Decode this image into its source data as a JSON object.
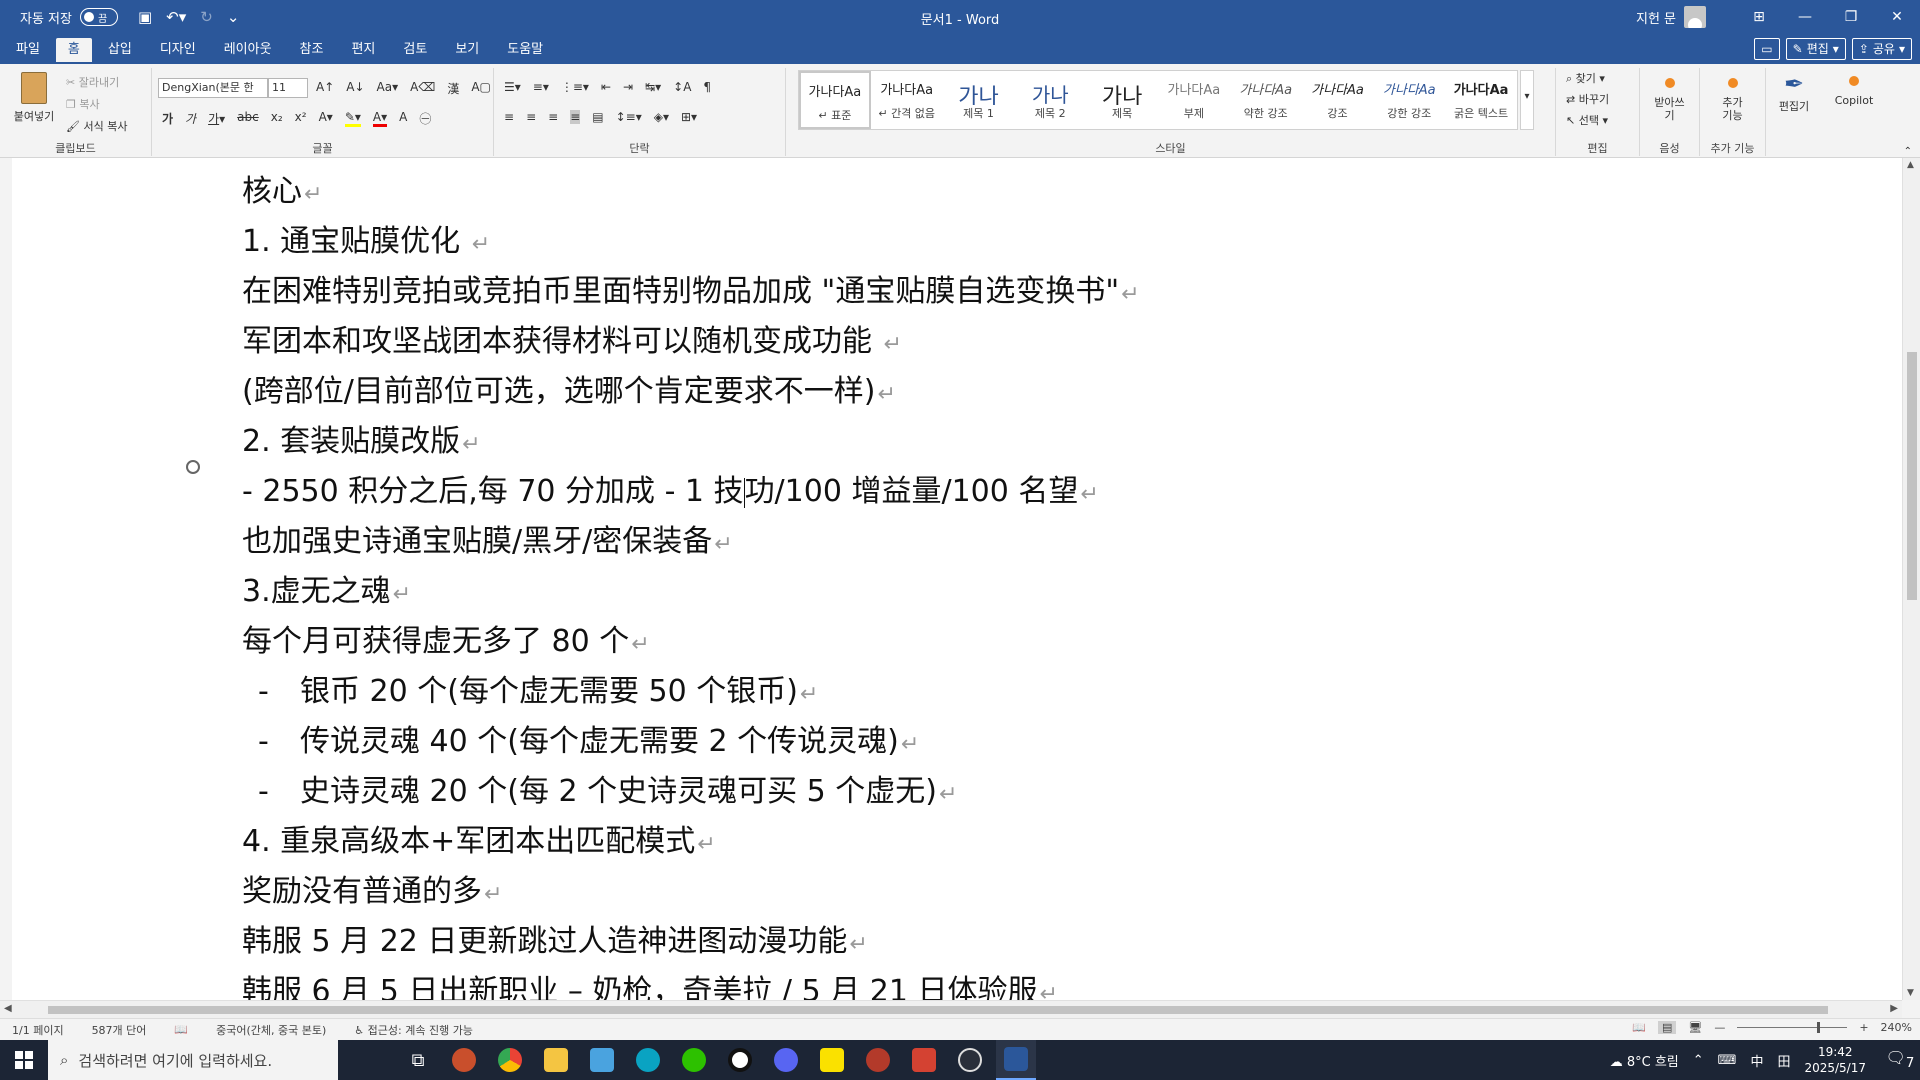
{
  "titlebar": {
    "autosave_label": "자동 저장",
    "autosave_state": "끔",
    "doc_title": "문서1  -  Word",
    "user_name": "지헌 문"
  },
  "tabs": [
    {
      "label": "파일"
    },
    {
      "label": "홈"
    },
    {
      "label": "삽입"
    },
    {
      "label": "디자인"
    },
    {
      "label": "레이아웃"
    },
    {
      "label": "참조"
    },
    {
      "label": "편지"
    },
    {
      "label": "검토"
    },
    {
      "label": "보기"
    },
    {
      "label": "도움말"
    }
  ],
  "tabs_right": {
    "edit_label": "편집",
    "share_label": "공유"
  },
  "ribbon": {
    "clipboard": {
      "paste": "붙여넣기",
      "cut": "잘라내기",
      "copy": "복사",
      "format_painter": "서식 복사",
      "group": "클립보드"
    },
    "font": {
      "name": "DengXian(본문 한",
      "size": "11",
      "group": "글꼴"
    },
    "paragraph": {
      "group": "단락"
    },
    "styles": {
      "group": "스타일",
      "items": [
        {
          "sample": "가나다Aa",
          "name": "↵ 표준"
        },
        {
          "sample": "가나다Aa",
          "name": "↵ 간격 없음"
        },
        {
          "sample": "가나",
          "name": "제목 1"
        },
        {
          "sample": "가나",
          "name": "제목 2"
        },
        {
          "sample": "가나",
          "name": "제목"
        },
        {
          "sample": "가나다Aa",
          "name": "부제"
        },
        {
          "sample": "가나다Aa",
          "name": "약한 강조"
        },
        {
          "sample": "가나다Aa",
          "name": "강조"
        },
        {
          "sample": "가나다Aa",
          "name": "강한 강조"
        },
        {
          "sample": "가나다Aa",
          "name": "굵은 텍스트"
        }
      ]
    },
    "editing": {
      "find": "찾기",
      "replace": "바꾸기",
      "select": "선택",
      "group": "편집"
    },
    "voice": {
      "dictate": "받아쓰기",
      "group": "음성"
    },
    "addins": {
      "label": "추가 기능",
      "group": "추가 기능"
    },
    "editor": {
      "label": "편집기"
    },
    "copilot": {
      "label": "Copilot"
    }
  },
  "document": {
    "lines": [
      {
        "text": "核心"
      },
      {
        "text": "1.  通宝贴膜优化 "
      },
      {
        "text": "在困难特别竞拍或竞拍币里面特别物品加成 \"通宝贴膜自选变换书\""
      },
      {
        "text": "军团本和攻坚战团本获得材料可以随机变成功能 "
      },
      {
        "text": "(跨部位/目前部位可选，选哪个肯定要求不一样)"
      },
      {
        "text": "2.  套装贴膜改版"
      },
      {
        "text_before": "- 2550 积分之后,每 70 分加成  - 1 技",
        "text_after": "功/100 增益量/100 名望"
      },
      {
        "text": "也加强史诗通宝贴膜/黑牙/密保装备"
      },
      {
        "text": "3.虚无之魂"
      },
      {
        "text": "每个月可获得虚无多了 80 个"
      },
      {
        "dash": "-",
        "text": "银币  20 个(每个虚无需要 50 个银币)"
      },
      {
        "dash": "-",
        "text": "传说灵魂  40 个(每个虚无需要 2 个传说灵魂)"
      },
      {
        "dash": "-",
        "text": "史诗灵魂  20 个(每 2 个史诗灵魂可买 5 个虚无)"
      },
      {
        "text": "4.  重泉高级本+军团本出匹配模式"
      },
      {
        "text": "奖励没有普通的多"
      },
      {
        "text": "韩服 5 月 22 日更新跳过人造神进图动漫功能"
      },
      {
        "text": "韩服 6 月 5 日出新职业 – 奶枪，奇美拉  / 5 月 21 日体验服"
      }
    ],
    "para_mark": "↵"
  },
  "statusbar": {
    "page": "1/1 페이지",
    "words": "587개 단어",
    "language": "중국어(간체, 중국 본토)",
    "accessibility": "접근성: 계속 진행 가능",
    "zoom": "240%"
  },
  "taskbar": {
    "search_placeholder": "검색하려면 여기에 입력하세요.",
    "weather": "8°C  흐림",
    "ime": "中",
    "time": "19:42",
    "date": "2025/5/17",
    "notif_count": "7"
  }
}
